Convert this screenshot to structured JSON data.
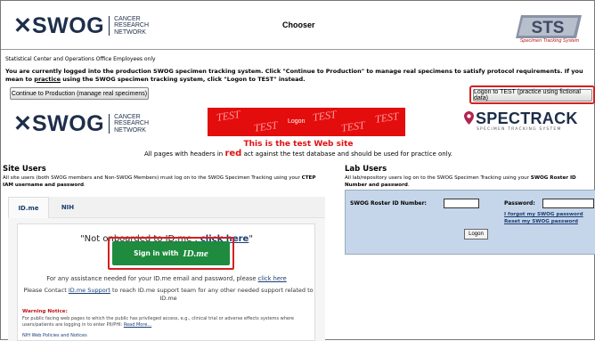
{
  "top": {
    "logo": {
      "word": "SWOG",
      "sub1": "CANCER",
      "sub2": "RESEARCH",
      "sub3": "NETWORK"
    },
    "title": "Chooser",
    "sts_logo": {
      "letters": "STS",
      "tagline": "Specimen Tracking System"
    }
  },
  "chooser": {
    "staff_note": "Statistical Center and Operations Office Employees only",
    "message_a": "You are currently logged into the production SWOG specimen tracking system. Click \"Continue to Production\" to manage real specimens to satisfy protocol requirements. If you mean to ",
    "message_practice": "practice",
    "message_b": " using the SWOG specimen tracking system, click \"Logon to TEST\" instead.",
    "btn_production": "Continue to Production (manage real specimens)",
    "btn_test": "Logon to TEST (practice using fictional data)"
  },
  "test_header": {
    "logo": {
      "word": "SWOG",
      "sub1": "CANCER",
      "sub2": "RESEARCH",
      "sub3": "NETWORK"
    },
    "watermark": "TEST",
    "banner_label": "Logon",
    "spectrack": {
      "name": "SPECTRACK",
      "tagline": "SPECIMEN TRACKING SYSTEM"
    },
    "warning": "This is the test Web site",
    "sub_a": "All pages with headers in ",
    "sub_red": "red",
    "sub_b": " act against the test database and should be used for practice only."
  },
  "site_users": {
    "heading": "Site Users",
    "desc_a": "All site users (both SWOG members and Non-SWOG Members) must log on to the SWOG Specimen Tracking using your ",
    "desc_bold": "CTEP IAM username and password",
    "desc_b": ".",
    "tabs": [
      "ID.me",
      "NIH"
    ],
    "not_onboarded_a": "\"Not onboarded to ID.me , ",
    "not_onboarded_link": "click here",
    "not_onboarded_b": "\"",
    "sign_in_label": "Sign in with",
    "sign_in_brand": "ID.me",
    "assist_a": "For any assistance needed for your ID.me email and password, please ",
    "assist_link": "click here",
    "contact_a": "Please Contact ",
    "contact_link": "ID.me Support",
    "contact_b": " to reach ID.me support team for any other needed support related to ID.me",
    "warning_heading": "Warning Notice:",
    "warning_text": "For public facing web pages to which the public has privileged access, e.g., clinical trial or adverse effects systems where users/patients are logging in to enter PII/PHI: ",
    "warning_link": "Read More...",
    "nih_policies": "NIH Web Policies and Notices"
  },
  "lab_users": {
    "heading": "Lab Users",
    "desc_a": "All lab/repository users log on to the SWOG Specimen Tracking using your ",
    "desc_bold": "SWOG Roster ID Number and password",
    "desc_b": ".",
    "roster_label": "SWOG Roster ID Number:",
    "password_label": "Password:",
    "forgot_link": "I forgot my SWOG password",
    "reset_link": "Reset my SWOG password",
    "logon_button": "Logon"
  },
  "colors": {
    "navy": "#1e2e4a",
    "test_red": "#e30d0d",
    "idme_green": "#1e8b3f",
    "link_blue": "#1a3d74",
    "lab_panel": "#c6d6ea"
  }
}
